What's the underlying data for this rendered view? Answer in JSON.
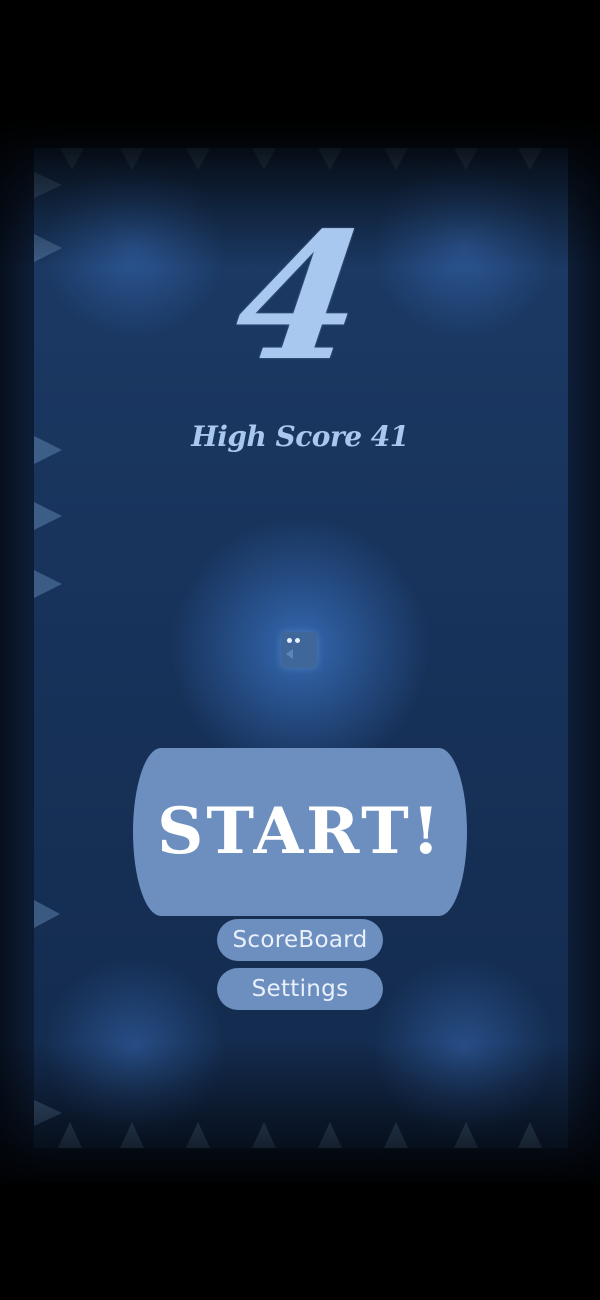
{
  "game": {
    "current_score": "4",
    "high_score_label": "High Score 41"
  },
  "menu": {
    "start_label": "START!",
    "scoreboard_label": "ScoreBoard",
    "settings_label": "Settings"
  },
  "colors": {
    "accent": "#6d8fbf",
    "score_text": "#a9c8ef",
    "arena_bg": "#17325a",
    "page_bg": "#000000"
  },
  "icons": {
    "player": "player-cube-icon",
    "hazards": "spike-icon"
  }
}
